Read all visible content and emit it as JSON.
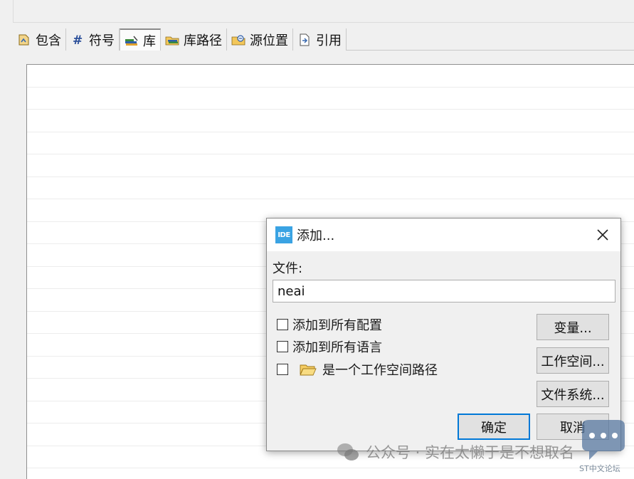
{
  "tabs": [
    {
      "label": "包含",
      "icon": "include-icon"
    },
    {
      "label": "符号",
      "icon": "hash-icon"
    },
    {
      "label": "库",
      "icon": "library-icon"
    },
    {
      "label": "库路径",
      "icon": "library-path-icon"
    },
    {
      "label": "源位置",
      "icon": "source-location-icon"
    },
    {
      "label": "引用",
      "icon": "reference-icon"
    }
  ],
  "active_tab": "库",
  "dialog": {
    "icon_text": "IDE",
    "title": "添加...",
    "file_label": "文件:",
    "file_value": "neai",
    "checkboxes": [
      {
        "label": "添加到所有配置",
        "checked": false
      },
      {
        "label": "添加到所有语言",
        "checked": false
      },
      {
        "label": "是一个工作空间路径",
        "checked": false
      }
    ],
    "buttons": {
      "variables": "变量...",
      "workspace": "工作空间...",
      "filesystem": "文件系统...",
      "ok": "确定",
      "cancel": "取消"
    }
  },
  "watermark": {
    "text": "公众号 · 实在太懒于是不想取名",
    "badge_text": "ST中文论坛"
  },
  "colors": {
    "accent": "#0078d7",
    "ide_icon": "#3aa3e3",
    "background": "#f0f0f0"
  }
}
